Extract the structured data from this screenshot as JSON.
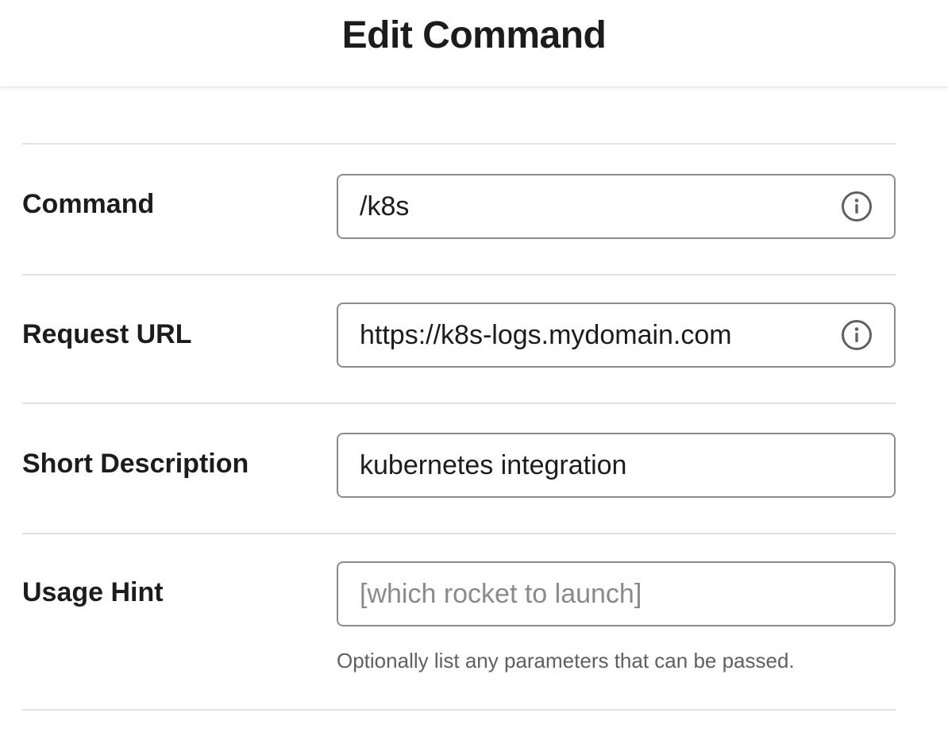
{
  "header": {
    "title": "Edit Command"
  },
  "form": {
    "command": {
      "label": "Command",
      "value": "/k8s",
      "icon": "info-icon"
    },
    "request_url": {
      "label": "Request URL",
      "value": "https://k8s-logs.mydomain.com",
      "icon": "info-icon"
    },
    "short_description": {
      "label": "Short Description",
      "value": "kubernetes integration"
    },
    "usage_hint": {
      "label": "Usage Hint",
      "value": "",
      "placeholder": "[which rocket to launch]",
      "help_text": "Optionally list any parameters that can be passed."
    }
  },
  "colors": {
    "text": "#1d1c1d",
    "border": "#8c8c8c",
    "divider": "#e2e2e2",
    "placeholder": "#8a8a8a",
    "help_text": "#616061"
  }
}
